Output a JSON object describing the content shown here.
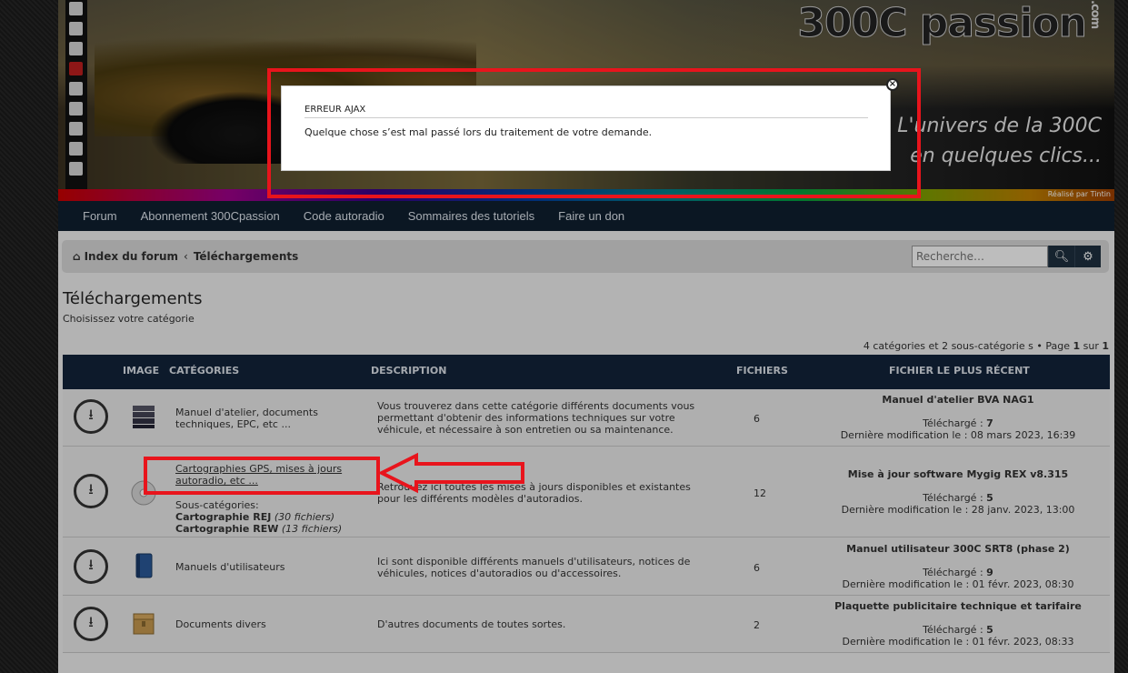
{
  "banner": {
    "logo": "300C passion",
    "logo_suffix": ".com",
    "tagline_line1": "L'univers de la 300C",
    "tagline_line2": "en quelques clics...",
    "credit": "Réalisé par Tintin"
  },
  "nav": {
    "items": [
      "Forum",
      "Abonnement 300Cpassion",
      "Code autoradio",
      "Sommaires des tutoriels",
      "Faire un don"
    ]
  },
  "breadcrumb": {
    "home": "Index du forum",
    "current": "Téléchargements"
  },
  "search": {
    "placeholder": "Recherche…"
  },
  "page": {
    "title": "Téléchargements",
    "subtitle": "Choisissez votre catégorie",
    "pagination_prefix": "4 catégories et 2 sous-catégorie s • Page ",
    "page_num": "1",
    "page_sep": " sur ",
    "page_total": "1"
  },
  "table": {
    "headers": {
      "image": "IMAGE",
      "categories": "CATÉGORIES",
      "description": "DESCRIPTION",
      "files": "FICHIERS",
      "recent": "FICHIER LE PLUS RÉCENT"
    },
    "rows": [
      {
        "category_line1": "Manuel d'atelier, documents",
        "category_line2": "techniques, EPC, etc ...",
        "desc_line1": "Vous trouverez dans cette catégorie différents documents vous",
        "desc_line2": "permettant d'obtenir des informations techniques sur votre",
        "desc_line3": "véhicule, et nécessaire à son entretien ou sa maintenance.",
        "files": "6",
        "recent_title": "Manuel d'atelier BVA NAG1",
        "recent_dl_label": "Téléchargé : ",
        "recent_dl": "7",
        "recent_mod": "Dernière modification le : 08 mars 2023, 16:39"
      },
      {
        "category_line1": "Cartographies GPS, mises à jours",
        "category_line2": "autoradio, etc ...",
        "subs_label": "Sous-catégories:",
        "sub1": "Cartographie REJ",
        "sub1_count": "(30 fichiers)",
        "sub2": "Cartographie REW",
        "sub2_count": "(13 fichiers)",
        "desc_line1": "Retrouvez ici toutes les mises à jours disponibles et existantes",
        "desc_line2": "pour les différents modèles d'autoradios.",
        "files": "12",
        "recent_title": "Mise à jour software Mygig REX v8.315",
        "recent_dl_label": "Téléchargé : ",
        "recent_dl": "5",
        "recent_mod": "Dernière modification le : 28 janv. 2023, 13:00"
      },
      {
        "category_line1": "Manuels d'utilisateurs",
        "desc_line1": "Ici sont disponible différents manuels d'utilisateurs, notices de",
        "desc_line2": "véhicules, notices d'autoradios ou d'accessoires.",
        "files": "6",
        "recent_title": "Manuel utilisateur 300C SRT8 (phase 2)",
        "recent_dl_label": "Téléchargé : ",
        "recent_dl": "9",
        "recent_mod": "Dernière modification le : 01 févr. 2023, 08:30"
      },
      {
        "category_line1": "Documents divers",
        "desc_line1": "D'autres documents de toutes sortes.",
        "files": "2",
        "recent_title": "Plaquette publicitaire technique et tarifaire",
        "recent_dl_label": "Téléchargé : ",
        "recent_dl": "5",
        "recent_mod": "Dernière modification le : 01 févr. 2023, 08:33"
      }
    ]
  },
  "modal": {
    "title": "ERREUR AJAX",
    "message": "Quelque chose s’est mal passé lors du traitement de votre demande.",
    "close": "×"
  },
  "colors": {
    "annotation_red": "#e8141c",
    "navbar": "#102030",
    "table_header": "#12243a"
  }
}
